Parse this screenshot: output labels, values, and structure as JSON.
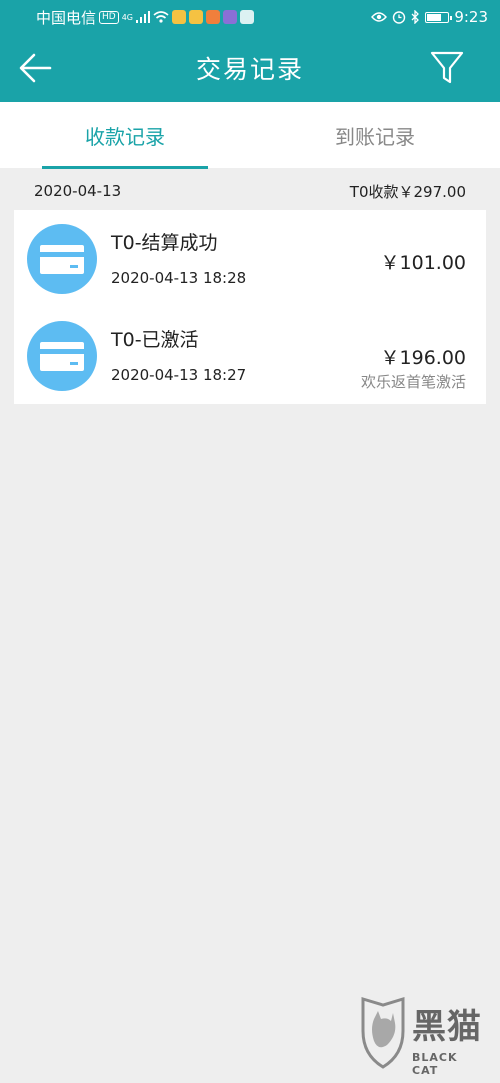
{
  "status_bar": {
    "carrier": "中国电信",
    "hd": "HD",
    "network": "4G",
    "time": "9:23"
  },
  "header": {
    "title": "交易记录",
    "back_icon": "arrow-left-icon",
    "filter_icon": "filter-icon"
  },
  "tabs": [
    {
      "label": "收款记录",
      "active": true
    },
    {
      "label": "到账记录",
      "active": false
    }
  ],
  "date_group": {
    "date": "2020-04-13",
    "summary": "T0收款￥297.00"
  },
  "transactions": [
    {
      "icon": "card-icon",
      "title": "T0-结算成功",
      "time": "2020-04-13 18:28",
      "amount": "￥101.00",
      "note": ""
    },
    {
      "icon": "card-icon",
      "title": "T0-已激活",
      "time": "2020-04-13 18:27",
      "amount": "￥196.00",
      "note": "欢乐返首笔激活"
    }
  ],
  "watermark": {
    "text": "黑猫",
    "sub": "BLACK CAT"
  },
  "colors": {
    "primary": "#1aa3a8",
    "icon_circle": "#5dbcf2",
    "background": "#eeeeee"
  }
}
